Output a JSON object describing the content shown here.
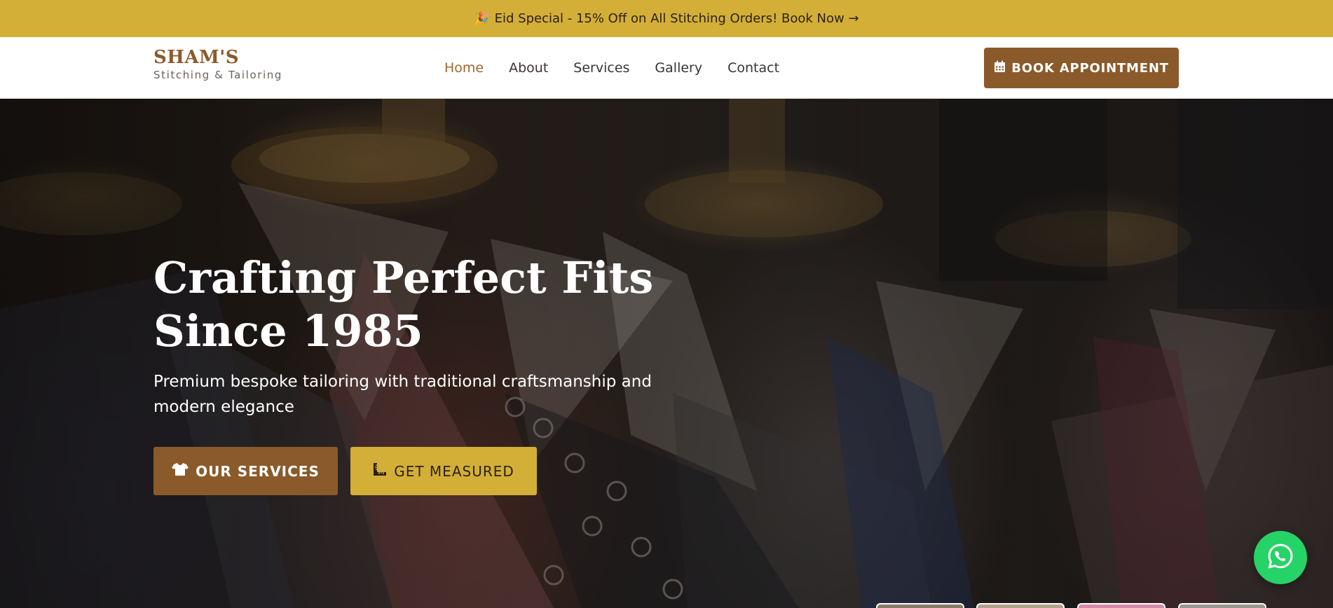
{
  "promo": {
    "icon": "party-popper-icon",
    "text": "Eid Special - 15% Off on All Stitching Orders! Book Now →"
  },
  "brand": {
    "title": "SHAM'S",
    "subtitle": "Stitching & Tailoring",
    "color": "#8b5a2b"
  },
  "nav": {
    "items": [
      {
        "label": "Home",
        "active": true
      },
      {
        "label": "About",
        "active": false
      },
      {
        "label": "Services",
        "active": false
      },
      {
        "label": "Gallery",
        "active": false
      },
      {
        "label": "Contact",
        "active": false
      }
    ],
    "book_button": {
      "label": "BOOK APPOINTMENT",
      "icon": "calendar-icon"
    }
  },
  "hero": {
    "title": "Crafting Perfect Fits Since 1985",
    "subtitle": "Premium bespoke tailoring with traditional craftsmanship and modern elegance",
    "buttons": [
      {
        "label": "OUR SERVICES",
        "icon": "shirt-icon"
      },
      {
        "label": "GET MEASURED",
        "icon": "ruler-icon"
      }
    ]
  },
  "floating": {
    "whatsapp_icon": "whatsapp-icon",
    "thumbnails_count": 4
  },
  "colors": {
    "accent_gold": "#d4af37",
    "brand_brown": "#8b5a2b",
    "whatsapp_green": "#25d366"
  }
}
